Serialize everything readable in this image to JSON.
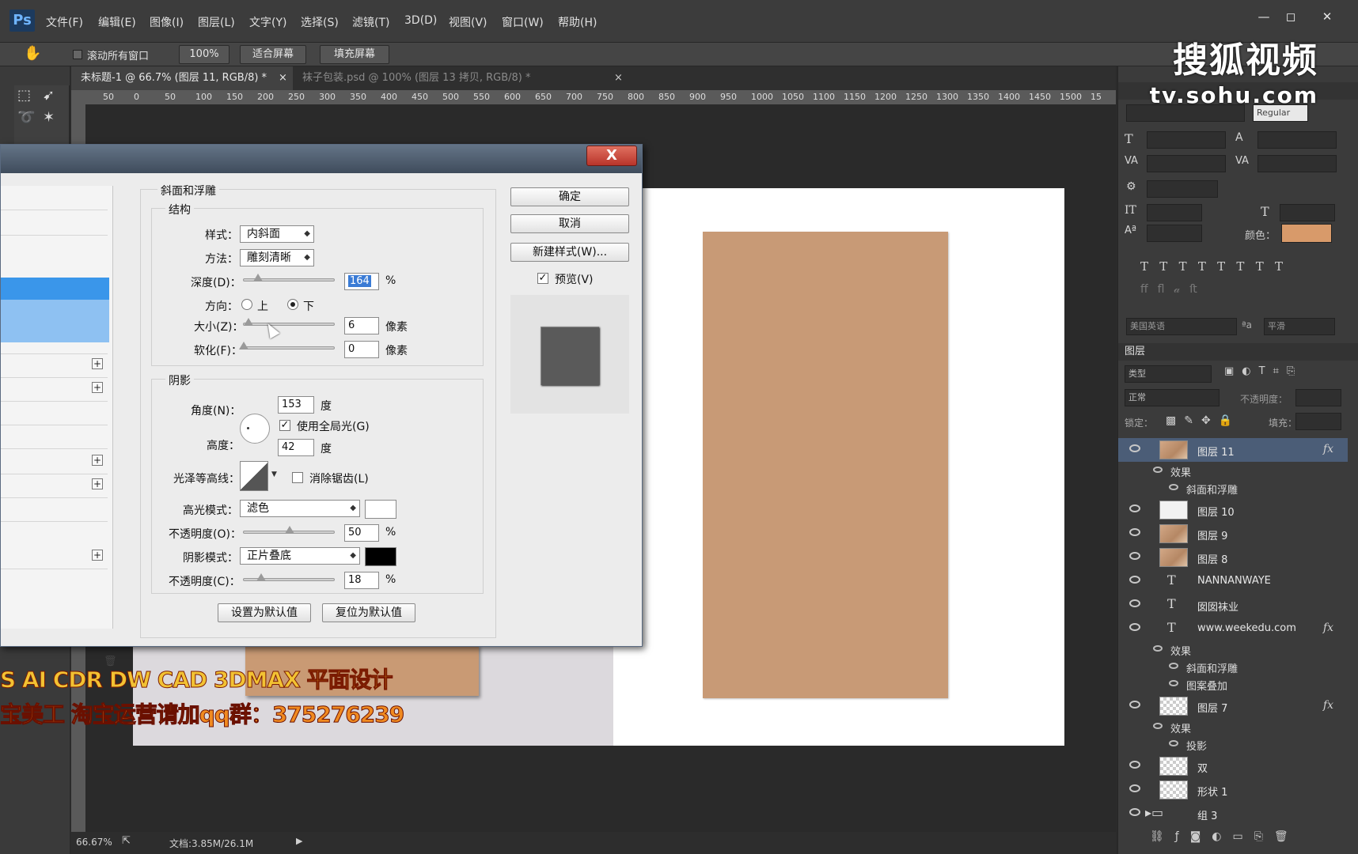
{
  "menubar": {
    "logo": "Ps",
    "items": [
      "文件(F)",
      "编辑(E)",
      "图像(I)",
      "图层(L)",
      "文字(Y)",
      "选择(S)",
      "滤镜(T)",
      "3D(D)",
      "视图(V)",
      "窗口(W)",
      "帮助(H)"
    ]
  },
  "options": {
    "scroll_all_label": "滚动所有窗口",
    "zoom_btn": "100%",
    "fit_btn": "适合屏幕",
    "fill_btn": "填充屏幕"
  },
  "tabs": [
    {
      "label": "未标题-1 @ 66.7% (图层 11, RGB/8) *",
      "active": true
    },
    {
      "label": "袜子包装.psd @ 100% (图层 13 拷贝, RGB/8) *",
      "active": false
    }
  ],
  "ruler_ticks": [
    "50",
    "0",
    "50",
    "100",
    "150",
    "200",
    "250",
    "300",
    "350",
    "400",
    "450",
    "500",
    "550",
    "600",
    "650",
    "700",
    "750",
    "800",
    "850",
    "900",
    "950",
    "1000",
    "1050",
    "1100",
    "1150",
    "1200",
    "1250",
    "1300",
    "1350",
    "1400",
    "1450",
    "1500",
    "15"
  ],
  "status": {
    "zoom": "66.67%",
    "doc": "文档:3.85M/26.1M"
  },
  "watermark": {
    "line1": "S AI CDR DW CAD 3DMAX 平面设计",
    "line2": "宝美工 淘宝运营请加qq群：375276239",
    "sohu_main": "搜狐视频",
    "sohu_url": "tv.sohu.com"
  },
  "char_panel": {
    "font_style": "Regular",
    "color_label": "颜色：",
    "color": "#d89a6a",
    "lang": "美国英语",
    "aa_mode": "平滑"
  },
  "layers_panel": {
    "title": "图层",
    "filter_label": "类型",
    "blend": "正常",
    "opacity_label": "不透明度：",
    "lock_label": "锁定：",
    "fill_label": "填充：",
    "layers": [
      {
        "name": "图层 11",
        "type": "img",
        "fx": true,
        "selected": true
      },
      {
        "name": "图层 10",
        "type": "plain"
      },
      {
        "name": "图层 9",
        "type": "img"
      },
      {
        "name": "图层 8",
        "type": "img"
      },
      {
        "name": "NANNANWAYE",
        "type": "text"
      },
      {
        "name": "囡囡袜业",
        "type": "text"
      },
      {
        "name": "www.weekedu.com",
        "type": "text",
        "fx": true
      },
      {
        "name": "图层 7",
        "type": "checker",
        "fx": true
      },
      {
        "name": "双",
        "type": "checker"
      },
      {
        "name": "形状 1",
        "type": "checker"
      },
      {
        "name": "组 3",
        "type": "group"
      }
    ],
    "effects_label": "效果",
    "bevel_label": "斜面和浮雕",
    "pattern_label": "图案叠加",
    "shadow_label": "投影",
    "fx_label": "fx"
  },
  "dialog": {
    "section_title": "斜面和浮雕",
    "structure_title": "结构",
    "style_label": "样式：",
    "style_value": "内斜面",
    "technique_label": "方法：",
    "technique_value": "雕刻清晰",
    "depth_label": "深度(D)：",
    "depth_value": "164",
    "depth_unit": "%",
    "direction_label": "方向：",
    "direction_up": "上",
    "direction_down": "下",
    "size_label": "大小(Z)：",
    "size_value": "6",
    "size_unit": "像素",
    "soften_label": "软化(F)：",
    "soften_value": "0",
    "soften_unit": "像素",
    "shading_title": "阴影",
    "angle_label": "角度(N)：",
    "angle_value": "153",
    "angle_unit": "度",
    "global_light_label": "使用全局光(G)",
    "altitude_label": "高度：",
    "altitude_value": "42",
    "altitude_unit": "度",
    "gloss_label": "光泽等高线：",
    "antialias_label": "消除锯齿(L)",
    "highlight_mode_label": "高光模式：",
    "highlight_mode_value": "滤色",
    "highlight_opacity_label": "不透明度(O)：",
    "highlight_opacity_value": "50",
    "highlight_color": "#ffffff",
    "shadow_mode_label": "阴影模式：",
    "shadow_mode_value": "正片叠底",
    "shadow_opacity_label": "不透明度(C)：",
    "shadow_opacity_value": "18",
    "shadow_color": "#000000",
    "pct": "%",
    "set_default_btn": "设置为默认值",
    "reset_default_btn": "复位为默认值",
    "ok_btn": "确定",
    "cancel_btn": "取消",
    "new_style_btn": "新建样式(W)...",
    "preview_label": "预览(V)",
    "close_glyph": "X"
  },
  "doc_colors": {
    "card": "#c89a76"
  }
}
